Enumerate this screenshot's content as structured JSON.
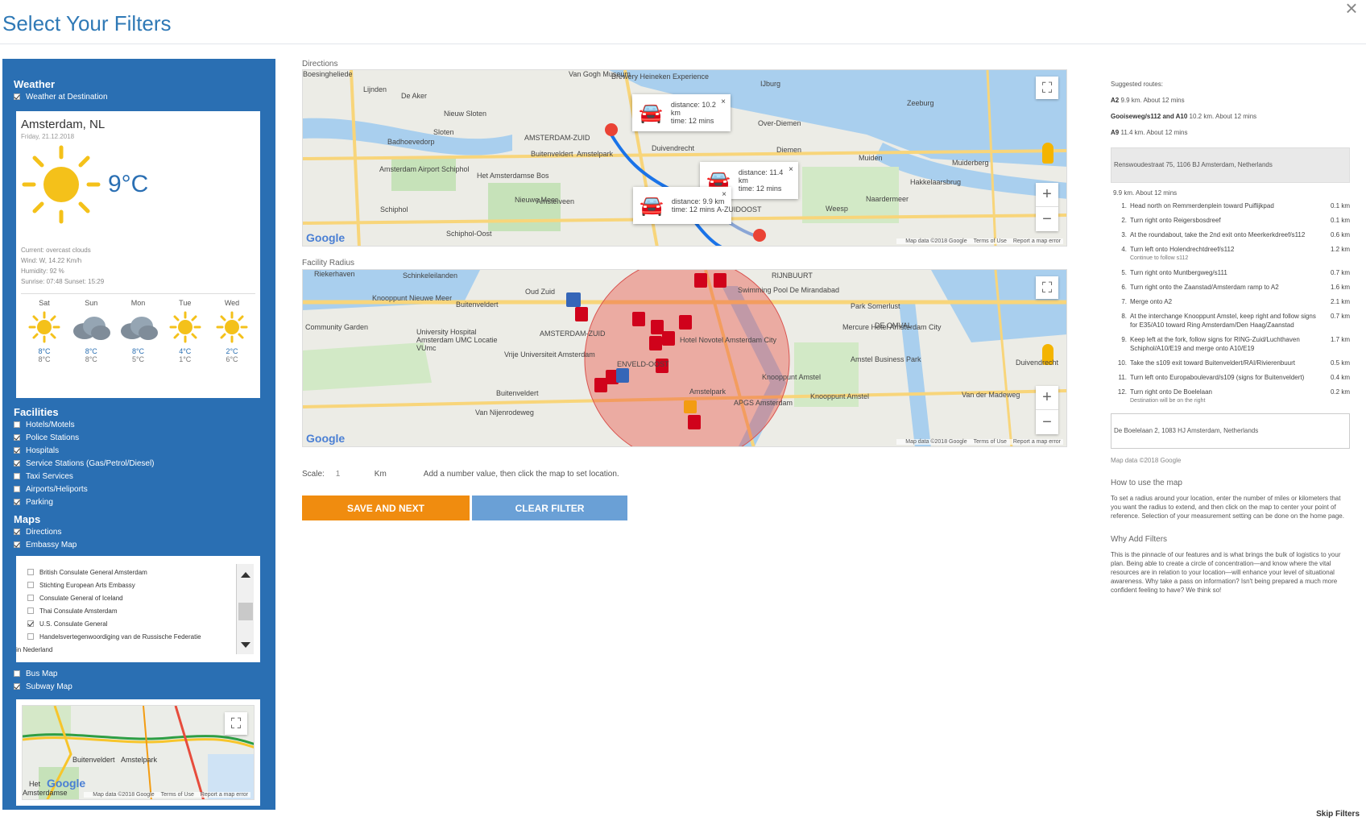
{
  "page": {
    "title": "Select Your Filters",
    "close": "×",
    "skip": "Skip Filters"
  },
  "sidebar": {
    "weather": {
      "title": "Weather",
      "checkbox": "Weather at Destination",
      "card": {
        "city": "Amsterdam, NL",
        "date": "Friday, 21.12.2018",
        "temp": "9°C",
        "current": "Current: overcast clouds",
        "wind": "Wind: W, 14.22 Km/h",
        "humidity": "Humidity: 92 %",
        "sun": "Sunrise: 07:48 Sunset: 15:29",
        "forecast": [
          {
            "day": "Sat",
            "icon": "sun-icon",
            "hi": "8°C",
            "lo": "8°C"
          },
          {
            "day": "Sun",
            "icon": "cloud-icon",
            "hi": "8°C",
            "lo": "8°C"
          },
          {
            "day": "Mon",
            "icon": "cloud-icon",
            "hi": "8°C",
            "lo": "5°C"
          },
          {
            "day": "Tue",
            "icon": "sun-icon",
            "hi": "4°C",
            "lo": "1°C"
          },
          {
            "day": "Wed",
            "icon": "sun-icon",
            "hi": "2°C",
            "lo": "6°C"
          }
        ]
      }
    },
    "facilities": {
      "title": "Facilities",
      "items": [
        {
          "label": "Hotels/Motels",
          "checked": false
        },
        {
          "label": "Police Stations",
          "checked": true
        },
        {
          "label": "Hospitals",
          "checked": true
        },
        {
          "label": "Service Stations (Gas/Petrol/Diesel)",
          "checked": true
        },
        {
          "label": "Taxi Services",
          "checked": false
        },
        {
          "label": "Airports/Heliports",
          "checked": false
        },
        {
          "label": "Parking",
          "checked": true
        }
      ]
    },
    "maps": {
      "title": "Maps",
      "directions": "Directions",
      "embassy": "Embassy Map",
      "embassy_list": [
        {
          "label": "British Consulate General Amsterdam",
          "checked": false
        },
        {
          "label": "Stichting European Arts Embassy",
          "checked": false
        },
        {
          "label": "Consulate General of Iceland",
          "checked": false
        },
        {
          "label": "Thai Consulate Amsterdam",
          "checked": false
        },
        {
          "label": "U.S. Consulate General",
          "checked": true
        },
        {
          "label": "Handelsvertegenwoordiging van de Russische Federatie",
          "checked": false
        }
      ],
      "embassy_list_wrap": "in Nederland",
      "bus": "Bus Map",
      "subway": "Subway Map"
    }
  },
  "directions_map": {
    "label": "Directions",
    "logo": "Google",
    "footer": [
      "Map data ©2018 Google",
      "Terms of Use",
      "Report a map error"
    ],
    "popups": [
      {
        "distance": "distance: 10.2 km",
        "time": "time: 12 mins"
      },
      {
        "distance": "distance: 11.4 km",
        "time": "time: 12 mins"
      },
      {
        "distance": "distance: 9.9 km",
        "time": "time: 12 mins"
      }
    ],
    "place_labels": [
      "Boesingheliede",
      "Lijnden",
      "De Aker",
      "Nieuw Sloten",
      "Sloten",
      "AMSTERDAM-ZUID",
      "Badhoevedorp",
      "Buitenveldert",
      "Amstelpark",
      "Duivendrecht",
      "Over-Diemen",
      "Amstelveen",
      "Schiphol",
      "Schiphol-Oost",
      "Het Amsterdamse Bos",
      "Amsterdam Airport Schiphol",
      "Nieuwe Meer",
      "IJburg",
      "Diemen",
      "Muiden",
      "Muiderberg",
      "Hakkelaarsbrug",
      "Naarder​meer",
      "Weesp",
      "A-ZUIDOOST",
      "Van Gogh Museum",
      "Brewery Heineken Experience",
      "Zeeburg"
    ]
  },
  "radius_map": {
    "label": "Facility Radius",
    "logo": "Google",
    "footer": [
      "Map data ©2018 Google",
      "Terms of Use",
      "Report a map error"
    ],
    "place_labels": [
      "Riekerhaven",
      "Schinkeleilanden",
      "Oud Zuid",
      "Knooppunt Nieuwe Meer",
      "Buitenveldert",
      "Community Garden",
      "University Hospital Amsterdam UMC Locatie VUmc",
      "Vrije Universiteit Amsterdam",
      "AMSTERDAM-ZUID",
      "Buitenveldert",
      "Van Nijenrodeweg",
      "Hotel Novotel Amsterdam City",
      "ENVELD-OOST",
      "Amstelpark",
      "Knooppunt Amstel",
      "APGS Amsterdam",
      "RIJNBUURT",
      "Swimming Pool De Mirandabad",
      "Park Somerlust",
      "DE OMVAL",
      "Mercure Hotel Amsterdam City",
      "Amstel Business Park",
      "Knooppunt Amstel",
      "Van der Madeweg",
      "Duivendrecht"
    ]
  },
  "subway_map": {
    "logo": "Google",
    "footer": [
      "Map data ©2018 Google",
      "Terms of Use",
      "Report a map error"
    ],
    "place_labels": [
      "Buitenveldert",
      "Amstelpark",
      "Het",
      "Amsterdamse"
    ]
  },
  "controls": {
    "scale_label": "Scale:",
    "scale_value": "1",
    "unit": "Km",
    "hint": "Add a number value, then click the map to set location.",
    "save_label": "SAVE AND NEXT",
    "clear_label": "CLEAR FILTER"
  },
  "right_panel": {
    "suggested": "Suggested routes:",
    "routes": [
      {
        "name": "A2",
        "rest": " 9.9 km. About 12 mins"
      },
      {
        "name": "Gooiseweg/s112 and A10",
        "rest": " 10.2 km. About 12 mins"
      },
      {
        "name": "A9",
        "rest": " 11.4 km. About 12 mins"
      }
    ],
    "start_address": "Renswoudestraat 75, 1106 BJ Amsterdam, Netherlands",
    "summary": "9.9 km. About 12 mins",
    "steps": [
      {
        "n": "1.",
        "text": "Head north on Remmerdenplein toward Puiflijkpad",
        "dist": "0.1 km",
        "sub": ""
      },
      {
        "n": "2.",
        "text": "Turn right onto Reigersbosdreef",
        "dist": "0.1 km",
        "sub": ""
      },
      {
        "n": "3.",
        "text": "At the roundabout, take the 2nd exit onto Meerkerkdreef/s112",
        "dist": "0.6 km",
        "sub": ""
      },
      {
        "n": "4.",
        "text": "Turn left onto Holendrechtdreef/s112",
        "dist": "1.2 km",
        "sub": "Continue to follow s112"
      },
      {
        "n": "5.",
        "text": "Turn right onto Muntbergweg/s111",
        "dist": "0.7 km",
        "sub": ""
      },
      {
        "n": "6.",
        "text": "Turn right onto the Zaanstad/Amsterdam ramp to A2",
        "dist": "1.6 km",
        "sub": ""
      },
      {
        "n": "7.",
        "text": "Merge onto A2",
        "dist": "2.1 km",
        "sub": ""
      },
      {
        "n": "8.",
        "text": "At the interchange Knooppunt Amstel, keep right and follow signs for E35/A10 toward Ring Amsterdam/Den Haag/Zaanstad",
        "dist": "0.7 km",
        "sub": ""
      },
      {
        "n": "9.",
        "text": "Keep left at the fork, follow signs for RING-Zuid/Luchthaven Schiphol/A10/E19 and merge onto A10/E19",
        "dist": "1.7 km",
        "sub": ""
      },
      {
        "n": "10.",
        "text": "Take the s109 exit toward Buitenveldert/RAI/Rivierenbuurt",
        "dist": "0.5 km",
        "sub": ""
      },
      {
        "n": "11.",
        "text": "Turn left onto Europaboulevard/s109 (signs for Buitenveldert)",
        "dist": "0.4 km",
        "sub": ""
      },
      {
        "n": "12.",
        "text": "Turn right onto De Boelelaan",
        "dist": "0.2 km",
        "sub": "Destination will be on the right"
      }
    ],
    "end_address": "De Boelelaan 2, 1083 HJ Amsterdam, Netherlands",
    "map_data": "Map data ©2018 Google",
    "how_title": "How to use the map",
    "how_text": "To set a radius around your location, enter the number of miles or kilometers that you want the radius to extend, and then click on the map to center your point of reference. Selection of your measurement setting can be done on the home page.",
    "why_title": "Why Add Filters",
    "why_text": "This is the pinnacle of our features and is what brings the bulk of logistics to your plan. Being able to create a circle of concentration—and know where the vital resources are in relation to your location—will enhance your level of situational awareness. Why take a pass on information? Isn't being prepared a much more confident feeling to have? We think so!"
  }
}
